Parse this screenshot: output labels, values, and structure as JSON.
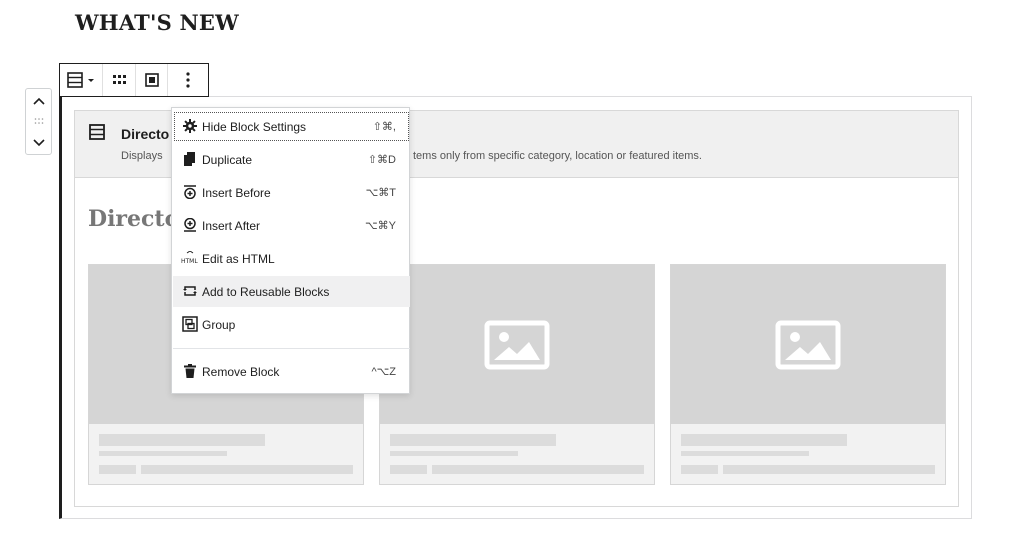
{
  "page": {
    "heading": "WHAT'S NEW"
  },
  "block": {
    "name": "Directo",
    "description_left": "Displays",
    "description_right": "tems only from specific category, location or featured items.",
    "preview_title": "Directo"
  },
  "menu": {
    "items": [
      {
        "label": "Hide Block Settings",
        "shortcut": "⇧⌘,",
        "icon": "gear-icon"
      },
      {
        "label": "Duplicate",
        "shortcut": "⇧⌘D",
        "icon": "duplicate-icon"
      },
      {
        "label": "Insert Before",
        "shortcut": "⌥⌘T",
        "icon": "insert-before-icon"
      },
      {
        "label": "Insert After",
        "shortcut": "⌥⌘Y",
        "icon": "insert-after-icon"
      },
      {
        "label": "Edit as HTML",
        "shortcut": "",
        "icon": "html-icon"
      },
      {
        "label": "Add to Reusable Blocks",
        "shortcut": "",
        "icon": "reusable-icon"
      },
      {
        "label": "Group",
        "shortcut": "",
        "icon": "group-icon"
      },
      {
        "label": "Remove Block",
        "shortcut": "^⌥Z",
        "icon": "trash-icon"
      }
    ],
    "html_icon_text": "HTML"
  },
  "colors": {
    "accent": "#1e1e1e",
    "placeholder": "#d5d5d5"
  }
}
